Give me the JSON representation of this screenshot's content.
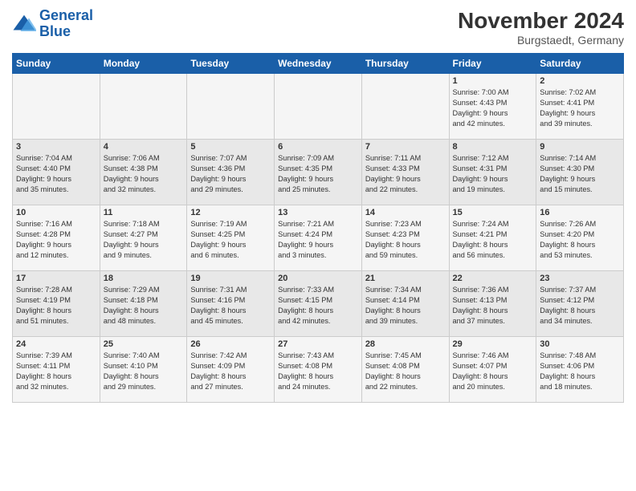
{
  "logo": {
    "line1": "General",
    "line2": "Blue"
  },
  "title": "November 2024",
  "location": "Burgstaedt, Germany",
  "weekdays": [
    "Sunday",
    "Monday",
    "Tuesday",
    "Wednesday",
    "Thursday",
    "Friday",
    "Saturday"
  ],
  "weeks": [
    [
      {
        "day": "",
        "info": ""
      },
      {
        "day": "",
        "info": ""
      },
      {
        "day": "",
        "info": ""
      },
      {
        "day": "",
        "info": ""
      },
      {
        "day": "",
        "info": ""
      },
      {
        "day": "1",
        "info": "Sunrise: 7:00 AM\nSunset: 4:43 PM\nDaylight: 9 hours\nand 42 minutes."
      },
      {
        "day": "2",
        "info": "Sunrise: 7:02 AM\nSunset: 4:41 PM\nDaylight: 9 hours\nand 39 minutes."
      }
    ],
    [
      {
        "day": "3",
        "info": "Sunrise: 7:04 AM\nSunset: 4:40 PM\nDaylight: 9 hours\nand 35 minutes."
      },
      {
        "day": "4",
        "info": "Sunrise: 7:06 AM\nSunset: 4:38 PM\nDaylight: 9 hours\nand 32 minutes."
      },
      {
        "day": "5",
        "info": "Sunrise: 7:07 AM\nSunset: 4:36 PM\nDaylight: 9 hours\nand 29 minutes."
      },
      {
        "day": "6",
        "info": "Sunrise: 7:09 AM\nSunset: 4:35 PM\nDaylight: 9 hours\nand 25 minutes."
      },
      {
        "day": "7",
        "info": "Sunrise: 7:11 AM\nSunset: 4:33 PM\nDaylight: 9 hours\nand 22 minutes."
      },
      {
        "day": "8",
        "info": "Sunrise: 7:12 AM\nSunset: 4:31 PM\nDaylight: 9 hours\nand 19 minutes."
      },
      {
        "day": "9",
        "info": "Sunrise: 7:14 AM\nSunset: 4:30 PM\nDaylight: 9 hours\nand 15 minutes."
      }
    ],
    [
      {
        "day": "10",
        "info": "Sunrise: 7:16 AM\nSunset: 4:28 PM\nDaylight: 9 hours\nand 12 minutes."
      },
      {
        "day": "11",
        "info": "Sunrise: 7:18 AM\nSunset: 4:27 PM\nDaylight: 9 hours\nand 9 minutes."
      },
      {
        "day": "12",
        "info": "Sunrise: 7:19 AM\nSunset: 4:25 PM\nDaylight: 9 hours\nand 6 minutes."
      },
      {
        "day": "13",
        "info": "Sunrise: 7:21 AM\nSunset: 4:24 PM\nDaylight: 9 hours\nand 3 minutes."
      },
      {
        "day": "14",
        "info": "Sunrise: 7:23 AM\nSunset: 4:23 PM\nDaylight: 8 hours\nand 59 minutes."
      },
      {
        "day": "15",
        "info": "Sunrise: 7:24 AM\nSunset: 4:21 PM\nDaylight: 8 hours\nand 56 minutes."
      },
      {
        "day": "16",
        "info": "Sunrise: 7:26 AM\nSunset: 4:20 PM\nDaylight: 8 hours\nand 53 minutes."
      }
    ],
    [
      {
        "day": "17",
        "info": "Sunrise: 7:28 AM\nSunset: 4:19 PM\nDaylight: 8 hours\nand 51 minutes."
      },
      {
        "day": "18",
        "info": "Sunrise: 7:29 AM\nSunset: 4:18 PM\nDaylight: 8 hours\nand 48 minutes."
      },
      {
        "day": "19",
        "info": "Sunrise: 7:31 AM\nSunset: 4:16 PM\nDaylight: 8 hours\nand 45 minutes."
      },
      {
        "day": "20",
        "info": "Sunrise: 7:33 AM\nSunset: 4:15 PM\nDaylight: 8 hours\nand 42 minutes."
      },
      {
        "day": "21",
        "info": "Sunrise: 7:34 AM\nSunset: 4:14 PM\nDaylight: 8 hours\nand 39 minutes."
      },
      {
        "day": "22",
        "info": "Sunrise: 7:36 AM\nSunset: 4:13 PM\nDaylight: 8 hours\nand 37 minutes."
      },
      {
        "day": "23",
        "info": "Sunrise: 7:37 AM\nSunset: 4:12 PM\nDaylight: 8 hours\nand 34 minutes."
      }
    ],
    [
      {
        "day": "24",
        "info": "Sunrise: 7:39 AM\nSunset: 4:11 PM\nDaylight: 8 hours\nand 32 minutes."
      },
      {
        "day": "25",
        "info": "Sunrise: 7:40 AM\nSunset: 4:10 PM\nDaylight: 8 hours\nand 29 minutes."
      },
      {
        "day": "26",
        "info": "Sunrise: 7:42 AM\nSunset: 4:09 PM\nDaylight: 8 hours\nand 27 minutes."
      },
      {
        "day": "27",
        "info": "Sunrise: 7:43 AM\nSunset: 4:08 PM\nDaylight: 8 hours\nand 24 minutes."
      },
      {
        "day": "28",
        "info": "Sunrise: 7:45 AM\nSunset: 4:08 PM\nDaylight: 8 hours\nand 22 minutes."
      },
      {
        "day": "29",
        "info": "Sunrise: 7:46 AM\nSunset: 4:07 PM\nDaylight: 8 hours\nand 20 minutes."
      },
      {
        "day": "30",
        "info": "Sunrise: 7:48 AM\nSunset: 4:06 PM\nDaylight: 8 hours\nand 18 minutes."
      }
    ]
  ]
}
